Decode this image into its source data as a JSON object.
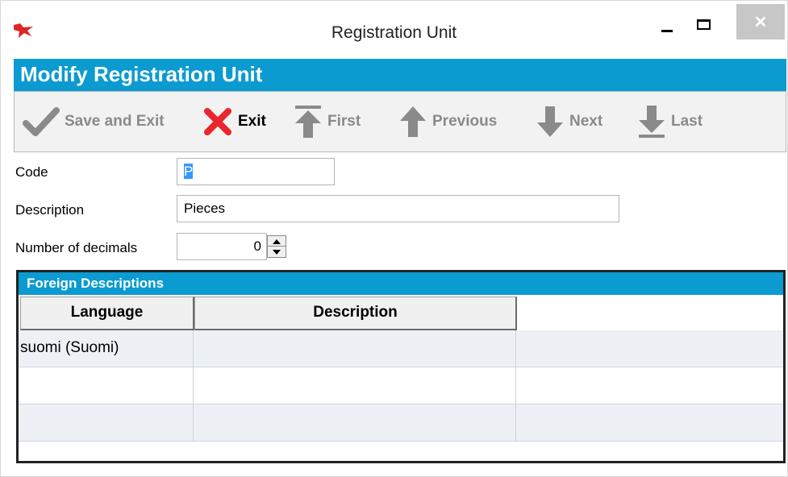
{
  "window": {
    "title": "Registration Unit",
    "minimize_label": "",
    "maximize_label": "",
    "close_label": "✕"
  },
  "header": {
    "title": "Modify Registration Unit"
  },
  "toolbar": {
    "save_exit": "Save and Exit",
    "exit": "Exit",
    "first": "First",
    "previous": "Previous",
    "next": "Next",
    "last": "Last"
  },
  "form": {
    "code_label": "Code",
    "code_value": "P",
    "description_label": "Description",
    "description_value": "Pieces",
    "decimals_label": "Number of decimals",
    "decimals_value": "0"
  },
  "foreign": {
    "title": "Foreign Descriptions",
    "columns": [
      "Language",
      "Description"
    ],
    "rows": [
      {
        "language": "suomi (Suomi)",
        "description": ""
      },
      {
        "language": "",
        "description": ""
      },
      {
        "language": "",
        "description": ""
      }
    ]
  },
  "colors": {
    "accent": "#0b9bd0",
    "exit_red": "#e8262b",
    "disabled_gray": "#8a8a8a"
  },
  "icons": [
    "app-logo-icon",
    "checkmark-icon",
    "close-x-icon",
    "arrow-first-icon",
    "arrow-up-icon",
    "arrow-down-icon",
    "arrow-last-icon"
  ]
}
